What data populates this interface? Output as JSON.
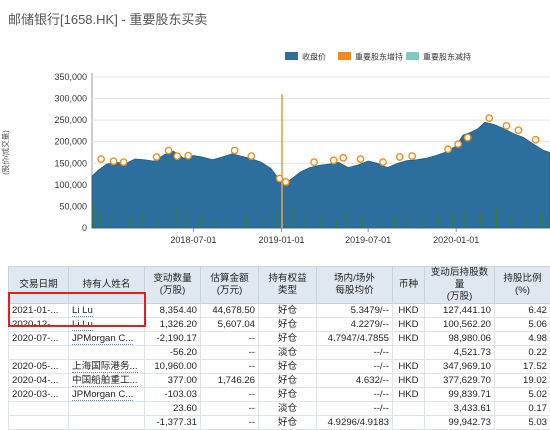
{
  "page": {
    "title": "邮储银行[1658.HK] - 重要股东买卖"
  },
  "legend": [
    {
      "label": "收盘价",
      "color": "#2c6e9e"
    },
    {
      "label": "重要股东增持",
      "color": "#f08c1a"
    },
    {
      "label": "重要股东减持",
      "color": "#7ecac0"
    }
  ],
  "chart_data": {
    "type": "area",
    "ylabel": "(股价/成交量)",
    "yticks": [
      "350,000",
      "300,000",
      "250,000",
      "200,000",
      "150,000",
      "100,000",
      "50,000",
      "0"
    ],
    "ylim": [
      0,
      350000
    ],
    "xticks": [
      "2018-07-01",
      "2019-01-01",
      "2019-07-01",
      "2020-01-01"
    ],
    "xlim": [
      "2017-12-01",
      "2020-07-15"
    ],
    "series": [
      {
        "name": "收盘价",
        "points": [
          [
            "2017-12-01",
            120000
          ],
          [
            "2017-12-15",
            135000
          ],
          [
            "2018-01-01",
            148000
          ],
          [
            "2018-01-20",
            152000
          ],
          [
            "2018-02-10",
            150000
          ],
          [
            "2018-03-01",
            160000
          ],
          [
            "2018-03-20",
            158000
          ],
          [
            "2018-04-10",
            155000
          ],
          [
            "2018-05-01",
            170000
          ],
          [
            "2018-05-20",
            178000
          ],
          [
            "2018-06-10",
            162000
          ],
          [
            "2018-07-01",
            168000
          ],
          [
            "2018-07-20",
            164000
          ],
          [
            "2018-08-10",
            158000
          ],
          [
            "2018-09-01",
            165000
          ],
          [
            "2018-09-20",
            172000
          ],
          [
            "2018-10-10",
            166000
          ],
          [
            "2018-11-01",
            160000
          ],
          [
            "2018-11-20",
            152000
          ],
          [
            "2018-12-10",
            138000
          ],
          [
            "2018-12-25",
            115000
          ],
          [
            "2019-01-05",
            100000
          ],
          [
            "2019-01-20",
            112000
          ],
          [
            "2019-02-10",
            130000
          ],
          [
            "2019-03-01",
            140000
          ],
          [
            "2019-03-20",
            145000
          ],
          [
            "2019-04-10",
            148000
          ],
          [
            "2019-05-01",
            152000
          ],
          [
            "2019-05-20",
            140000
          ],
          [
            "2019-06-10",
            146000
          ],
          [
            "2019-07-01",
            155000
          ],
          [
            "2019-07-20",
            150000
          ],
          [
            "2019-08-10",
            140000
          ],
          [
            "2019-09-01",
            150000
          ],
          [
            "2019-09-20",
            156000
          ],
          [
            "2019-10-10",
            158000
          ],
          [
            "2019-11-01",
            162000
          ],
          [
            "2019-11-20",
            168000
          ],
          [
            "2019-12-10",
            176000
          ],
          [
            "2020-01-01",
            190000
          ],
          [
            "2020-01-15",
            215000
          ],
          [
            "2020-02-01",
            222000
          ],
          [
            "2020-02-15",
            230000
          ],
          [
            "2020-03-01",
            245000
          ],
          [
            "2020-03-20",
            240000
          ],
          [
            "2020-04-10",
            230000
          ],
          [
            "2020-05-01",
            218000
          ],
          [
            "2020-05-20",
            210000
          ],
          [
            "2020-06-10",
            195000
          ],
          [
            "2020-07-01",
            180000
          ],
          [
            "2020-07-15",
            175000
          ]
        ]
      },
      {
        "name": "成交量",
        "bars": [
          [
            "2017-12-05",
            60000
          ],
          [
            "2017-12-20",
            40000
          ],
          [
            "2018-01-10",
            30000
          ],
          [
            "2018-02-20",
            25000
          ],
          [
            "2018-03-15",
            35000
          ],
          [
            "2018-04-20",
            20000
          ],
          [
            "2018-05-25",
            45000
          ],
          [
            "2018-06-15",
            30000
          ],
          [
            "2018-07-15",
            25000
          ],
          [
            "2018-08-20",
            20000
          ],
          [
            "2018-09-10",
            22000
          ],
          [
            "2018-10-20",
            30000
          ],
          [
            "2018-11-25",
            28000
          ],
          [
            "2018-12-20",
            40000
          ],
          [
            "2019-01-02",
            310000
          ],
          [
            "2019-01-25",
            50000
          ],
          [
            "2019-02-20",
            25000
          ],
          [
            "2019-03-25",
            30000
          ],
          [
            "2019-04-25",
            20000
          ],
          [
            "2019-05-15",
            35000
          ],
          [
            "2019-06-20",
            25000
          ],
          [
            "2019-07-25",
            22000
          ],
          [
            "2019-08-25",
            30000
          ],
          [
            "2019-09-25",
            28000
          ],
          [
            "2019-10-25",
            25000
          ],
          [
            "2019-11-25",
            30000
          ],
          [
            "2019-12-25",
            32000
          ],
          [
            "2020-01-20",
            40000
          ],
          [
            "2020-02-20",
            35000
          ],
          [
            "2020-03-25",
            45000
          ],
          [
            "2020-04-25",
            30000
          ],
          [
            "2020-05-25",
            28000
          ],
          [
            "2020-06-25",
            35000
          ],
          [
            "2020-07-10",
            25000
          ]
        ]
      },
      {
        "name": "重要股东增持",
        "points": [
          [
            "2017-12-20",
            155000
          ],
          [
            "2018-01-15",
            150000
          ],
          [
            "2018-02-05",
            148000
          ],
          [
            "2018-04-15",
            160000
          ],
          [
            "2018-05-10",
            175000
          ],
          [
            "2018-05-28",
            162000
          ],
          [
            "2018-06-20",
            163000
          ],
          [
            "2018-09-25",
            175000
          ],
          [
            "2018-10-30",
            162000
          ],
          [
            "2018-12-28",
            110000
          ],
          [
            "2019-01-10",
            102000
          ],
          [
            "2019-03-10",
            148000
          ],
          [
            "2019-04-20",
            152000
          ],
          [
            "2019-05-10",
            158000
          ],
          [
            "2019-06-15",
            155000
          ],
          [
            "2019-08-01",
            148000
          ],
          [
            "2019-09-05",
            160000
          ],
          [
            "2019-10-01",
            162000
          ],
          [
            "2019-12-15",
            178000
          ],
          [
            "2020-01-05",
            190000
          ],
          [
            "2020-01-25",
            205000
          ],
          [
            "2020-03-10",
            250000
          ],
          [
            "2020-04-15",
            232000
          ],
          [
            "2020-05-10",
            222000
          ],
          [
            "2020-06-15",
            200000
          ]
        ]
      }
    ]
  },
  "table": {
    "headers": [
      "交易日期",
      "持有人姓名",
      "变动数量\n(万股)",
      "估算金额\n(万元)",
      "持有权益\n类型",
      "场内/场外\n每股均价",
      "币种",
      "变动后持股数量\n(万股)",
      "持股比例\n(%)"
    ],
    "rows": [
      [
        "2021-01-...",
        "Li Lu",
        "8,354.40",
        "44,678.50",
        "好仓",
        "5.3479/--",
        "HKD",
        "127,441.10",
        "6.42"
      ],
      [
        "2020-12-...",
        "Li Lu",
        "1,326.20",
        "5,607.04",
        "好仓",
        "4.2279/--",
        "HKD",
        "100,562.20",
        "5.06"
      ],
      [
        "2020-07-...",
        "JPMorgan C...",
        "-2,190.17",
        "--",
        "好仓",
        "4.7947/4.7855",
        "HKD",
        "98,980.06",
        "4.98"
      ],
      [
        "",
        "",
        "-56.20",
        "--",
        "淡仓",
        "--/--",
        "",
        "4,521.73",
        "0.22"
      ],
      [
        "2020-05-...",
        "上海国际港务...",
        "10,960.00",
        "--",
        "好仓",
        "--/--",
        "HKD",
        "347,969.10",
        "17.52"
      ],
      [
        "2020-04-...",
        "中国船舶重工...",
        "377.00",
        "1,746.26",
        "好仓",
        "4.632/--",
        "HKD",
        "377,629.70",
        "19.02"
      ],
      [
        "2020-03-...",
        "JPMorgan C...",
        "-103.03",
        "--",
        "好仓",
        "--/--",
        "HKD",
        "99,839.71",
        "5.02"
      ],
      [
        "",
        "",
        "23.60",
        "--",
        "淡仓",
        "--/--",
        "",
        "3,433.61",
        "0.17"
      ],
      [
        "",
        "",
        "-1,377.31",
        "--",
        "好仓",
        "4.9296/4.9183",
        "",
        "99,942.73",
        "5.03"
      ]
    ]
  }
}
